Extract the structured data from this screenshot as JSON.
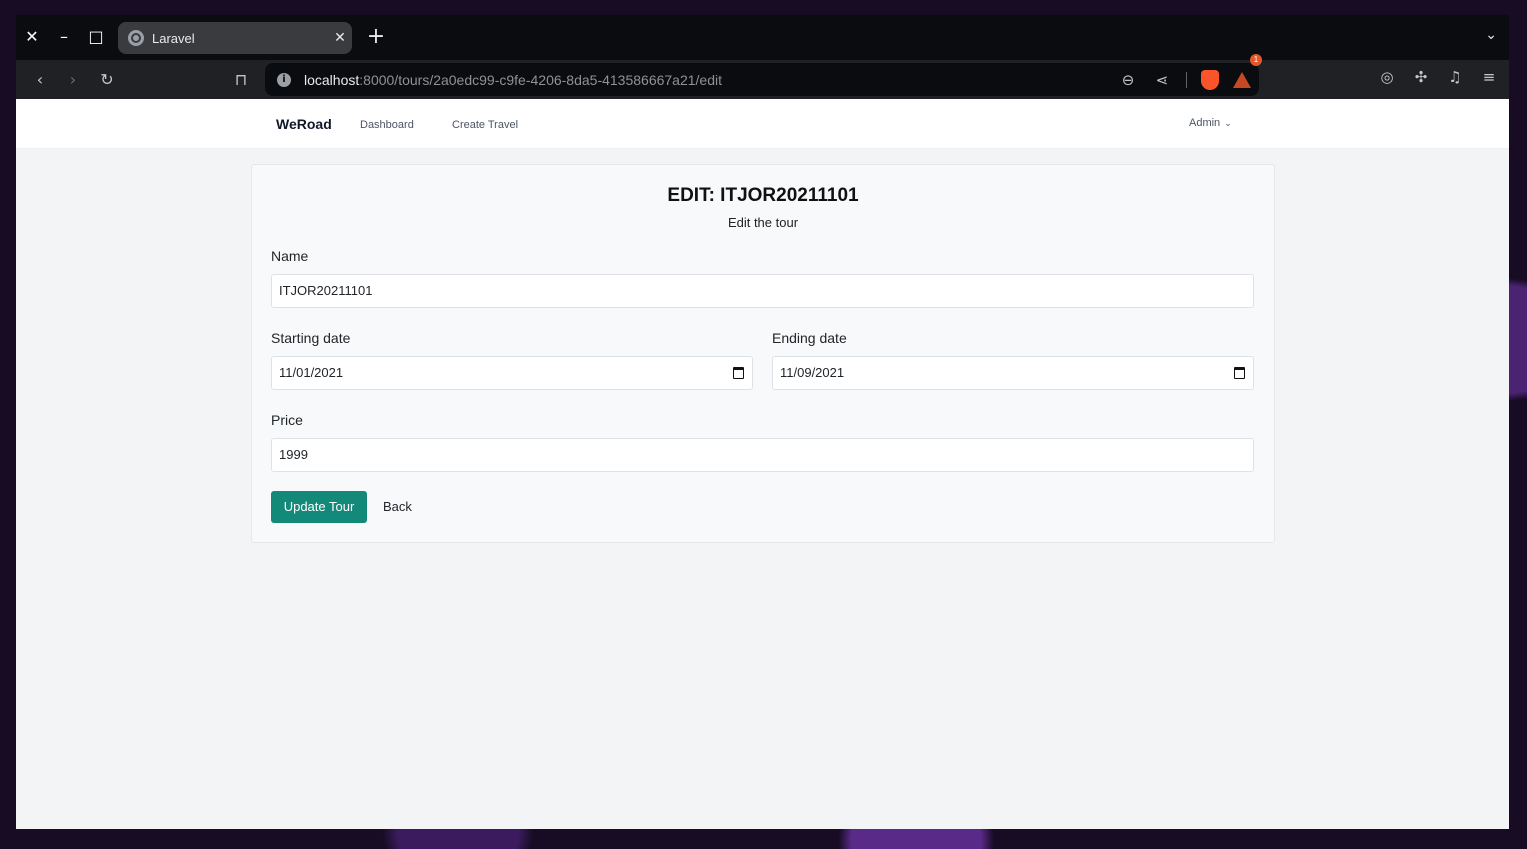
{
  "browser": {
    "tab_title": "Laravel",
    "url_host": "localhost",
    "url_path": ":8000/tours/2a0edc99-c9fe-4206-8da5-413586667a21/edit",
    "rewards_badge": "1"
  },
  "nav": {
    "brand": "WeRoad",
    "links": [
      "Dashboard",
      "Create Travel"
    ],
    "user": "Admin"
  },
  "form": {
    "title": "EDIT: ITJOR20211101",
    "subtitle": "Edit the tour",
    "name_label": "Name",
    "name_value": "ITJOR20211101",
    "start_label": "Starting date",
    "start_value": "11/01/2021",
    "end_label": "Ending date",
    "end_value": "11/09/2021",
    "price_label": "Price",
    "price_value": "1999",
    "update_button": "Update Tour",
    "back_link": "Back"
  },
  "colors": {
    "accent": "#13897a",
    "page_bg": "#f3f4f6"
  }
}
